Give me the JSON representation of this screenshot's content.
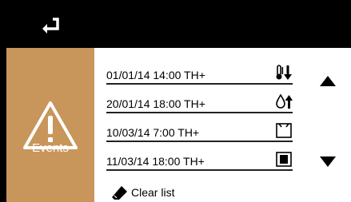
{
  "header": {
    "back_icon": "return-arrow-icon"
  },
  "sidebar": {
    "events_label": "Events",
    "events_icon": "warning-triangle-icon"
  },
  "events": [
    {
      "text": "01/01/14 14:00 TH+",
      "icon": "thermometer-down-icon"
    },
    {
      "text": "20/01/14 18:00 TH+",
      "icon": "drop-up-icon"
    },
    {
      "text": "10/03/14 7:00 TH+",
      "icon": "open-window-icon"
    },
    {
      "text": "11/03/14 18:00 TH+",
      "icon": "closed-window-icon"
    }
  ],
  "controls": {
    "scroll_up_icon": "triangle-up-icon",
    "scroll_down_icon": "triangle-down-icon",
    "clear_label": "Clear list",
    "clear_icon": "eraser-icon"
  },
  "colors": {
    "sidebar": "#c8965a",
    "background": "#000000",
    "panel": "#ffffff"
  }
}
